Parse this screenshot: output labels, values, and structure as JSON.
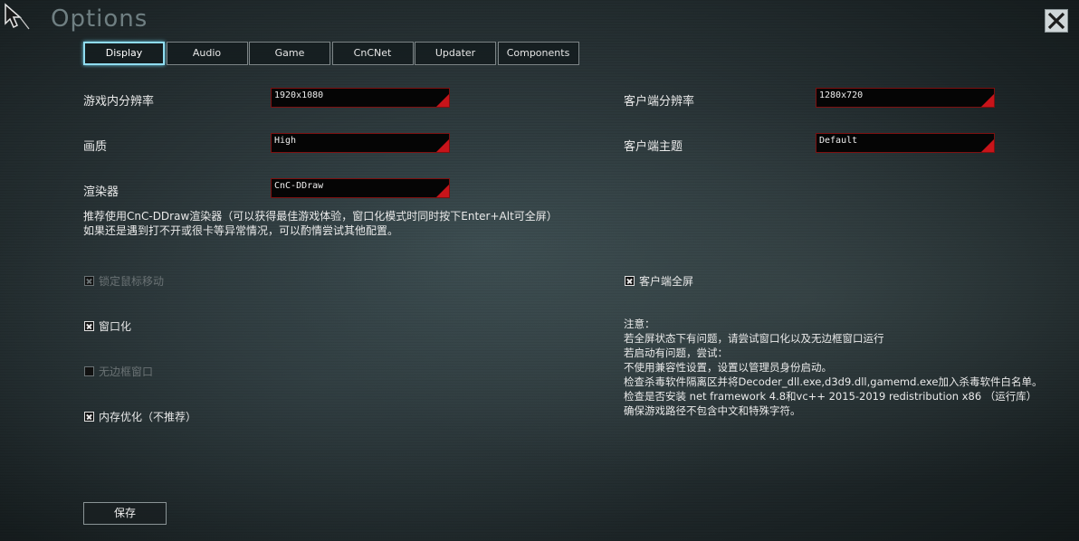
{
  "window": {
    "title": "Options"
  },
  "tabs": [
    {
      "label": "Display",
      "active": true
    },
    {
      "label": "Audio",
      "active": false
    },
    {
      "label": "Game",
      "active": false
    },
    {
      "label": "CnCNet",
      "active": false
    },
    {
      "label": "Updater",
      "active": false
    },
    {
      "label": "Components",
      "active": false
    }
  ],
  "display": {
    "ingame_resolution": {
      "label": "游戏内分辨率",
      "value": "1920x1080"
    },
    "quality": {
      "label": "画质",
      "value": "High"
    },
    "renderer": {
      "label": "渲染器",
      "value": "CnC-DDraw"
    },
    "client_resolution": {
      "label": "客户端分辨率",
      "value": "1280x720"
    },
    "client_theme": {
      "label": "客户端主题",
      "value": "Default"
    },
    "renderer_note": [
      "推荐使用CnC-DDraw渲染器（可以获得最佳游戏体验，窗口化模式时同时按下Enter+Alt可全屏）",
      "如果还是遇到打不开或很卡等异常情况，可以酌情尝试其他配置。"
    ],
    "checkboxes": {
      "lock_mouse": {
        "label": "锁定鼠标移动",
        "checked": true,
        "enabled": false
      },
      "windowed": {
        "label": "窗口化",
        "checked": true,
        "enabled": true
      },
      "borderless": {
        "label": "无边框窗口",
        "checked": false,
        "enabled": false
      },
      "memory_opt": {
        "label": "内存优化（不推荐）",
        "checked": true,
        "enabled": true
      },
      "client_fullscreen": {
        "label": "客户端全屏",
        "checked": true,
        "enabled": true
      }
    },
    "notes": [
      "注意：",
      "若全屏状态下有问题，请尝试窗口化以及无边框窗口运行",
      "若启动有问题，尝试：",
      "不使用兼容性设置，设置以管理员身份启动。",
      "检查杀毒软件隔离区并将Decoder_dll.exe,d3d9.dll,gamemd.exe加入杀毒软件白名单。",
      "检查是否安装 net framework 4.8和vc++ 2015-2019 redistribution x86 （运行库）",
      "确保游戏路径不包含中文和特殊字符。"
    ]
  },
  "footer": {
    "save_label": "保存"
  },
  "colors": {
    "accent_active_tab": "#8fdcf0",
    "dropdown_arrow": "#c8141a"
  },
  "icons": {
    "cursor": "cursor-pointer-icon",
    "close": "close-x-icon"
  }
}
